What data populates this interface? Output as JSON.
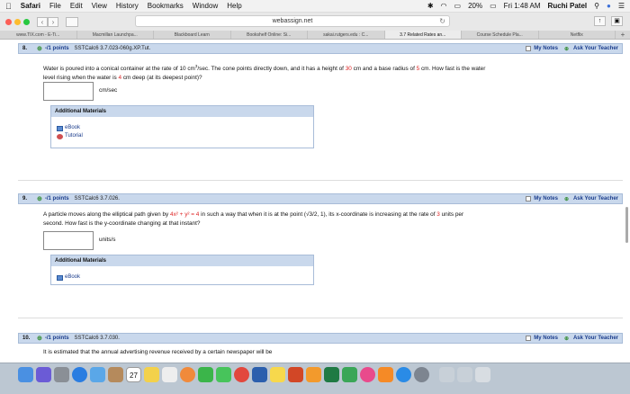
{
  "menubar": {
    "app": "Safari",
    "menus": [
      "File",
      "Edit",
      "View",
      "History",
      "Bookmarks",
      "Window",
      "Help"
    ],
    "battery": "20%",
    "clock": "Fri 1:48 AM",
    "user": "Ruchi Patel"
  },
  "toolbar": {
    "address": "webassign.net"
  },
  "tabs": [
    {
      "label": "www.TIX.com - E-Ti..."
    },
    {
      "label": "Macmillan Launchpa..."
    },
    {
      "label": "Blackboard Learn"
    },
    {
      "label": "Bookshelf Online: Si..."
    },
    {
      "label": "sakai.rutgers.edu : C..."
    },
    {
      "label": "3.7 Related Rates an..."
    },
    {
      "label": "Course Schedule Pla..."
    },
    {
      "label": "Netflix"
    }
  ],
  "questions": [
    {
      "num": "8.",
      "points": "-/1 points",
      "source": "SSTCalc6 3.7.023-060g.XP.Tut.",
      "notes": "My Notes",
      "ask": "Ask Your Teacher",
      "text_a": "Water is poured into a conical container at the rate of 10 cm",
      "text_sup": "3",
      "text_b": "/sec. The cone points directly down, and it has a height of ",
      "height": "30",
      "text_c": " cm and a base radius of ",
      "radius": "5",
      "text_d": " cm. How fast is the water",
      "text_line2a": "level rising when the water is ",
      "depth": "4",
      "text_line2b": " cm deep (at its deepest point)?",
      "unit": "cm/sec",
      "materials_title": "Additional Materials",
      "material_1": "eBook",
      "material_2": "Tutorial"
    },
    {
      "num": "9.",
      "points": "-/1 points",
      "source": "SSTCalc6 3.7.026.",
      "notes": "My Notes",
      "ask": "Ask Your Teacher",
      "text_a": "A particle moves along the elliptical path given by ",
      "equation": "4x² + y² = 4",
      "text_b": " in such a way that when it is at the point ",
      "point": "(√3/2, 1),",
      "text_c": " its x-coordinate is increasing at the rate of ",
      "rate": "3",
      "text_d": " units per",
      "text_line2": "second. How fast is the y-coordinate changing at that instant?",
      "unit": "units/s",
      "materials_title": "Additional Materials",
      "material_1": "eBook"
    },
    {
      "num": "10.",
      "points": "-/1 points",
      "source": "SSTCalc6 3.7.030.",
      "notes": "My Notes",
      "ask": "Ask Your Teacher",
      "text": "It is estimated that the annual advertising revenue received by a certain newspaper will be"
    }
  ],
  "dock": {
    "calendar_day": "27"
  }
}
